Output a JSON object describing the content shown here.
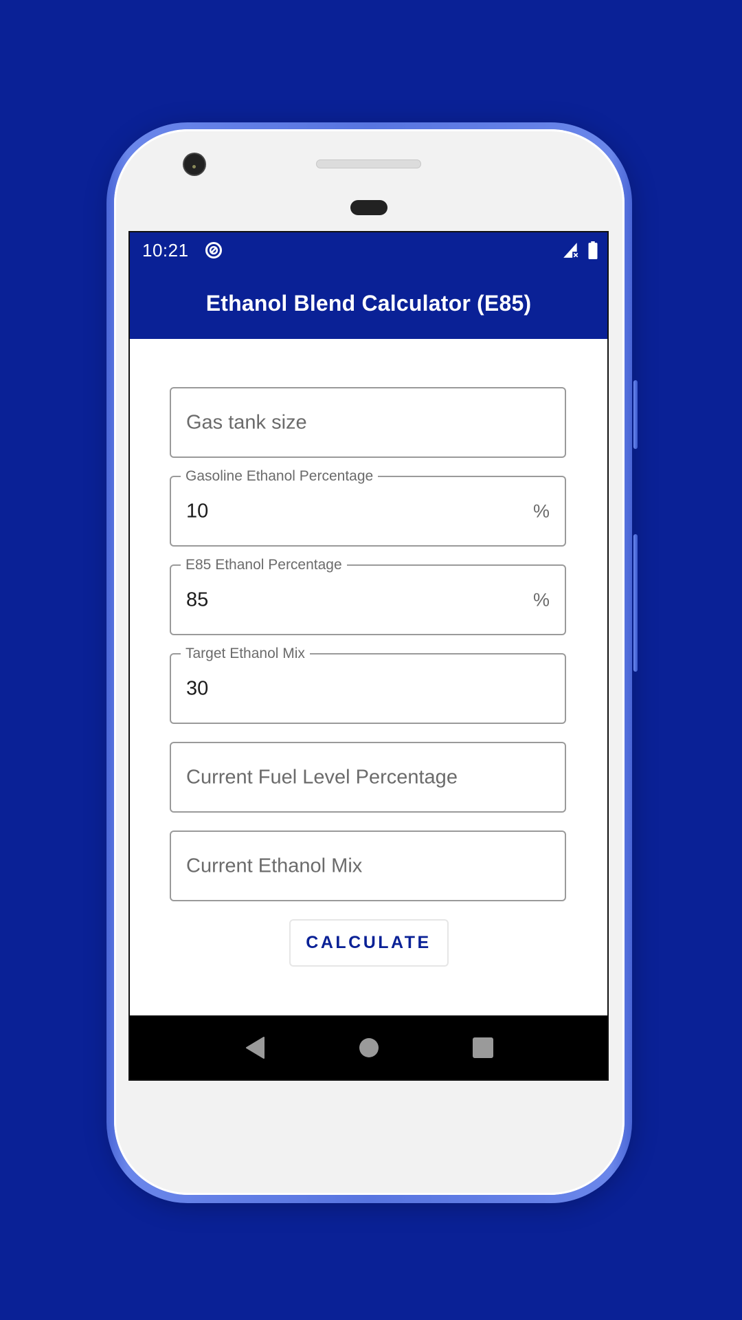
{
  "colors": {
    "background": "#0a2196",
    "app_bar": "#0a2196",
    "accent": "#0a2196",
    "field_border": "#9a9a9a",
    "hint_text": "#6b6b6b",
    "value_text": "#1c1c1c",
    "nav_bar": "#000000"
  },
  "status_bar": {
    "time": "10:21",
    "app_icon": "data-saver-icon",
    "signal_icon": "signal-no-data-icon",
    "battery_icon": "battery-full-icon"
  },
  "app_bar": {
    "title": "Ethanol Blend Calculator (E85)"
  },
  "form": {
    "fields": [
      {
        "name": "gas-tank-size",
        "label": "",
        "placeholder": "Gas tank size",
        "value": "",
        "suffix": ""
      },
      {
        "name": "gasoline-ethanol-percentage",
        "label": "Gasoline Ethanol Percentage",
        "placeholder": "",
        "value": "10",
        "suffix": "%"
      },
      {
        "name": "e85-ethanol-percentage",
        "label": "E85 Ethanol Percentage",
        "placeholder": "",
        "value": "85",
        "suffix": "%"
      },
      {
        "name": "target-ethanol-mix",
        "label": "Target Ethanol Mix",
        "placeholder": "",
        "value": "30",
        "suffix": ""
      },
      {
        "name": "current-fuel-level-percentage",
        "label": "",
        "placeholder": "Current Fuel Level Percentage",
        "value": "",
        "suffix": ""
      },
      {
        "name": "current-ethanol-mix",
        "label": "",
        "placeholder": "Current Ethanol Mix",
        "value": "",
        "suffix": ""
      }
    ],
    "calculate_label": "CALCULATE"
  },
  "nav_bar": {
    "back_icon": "back-triangle-icon",
    "home_icon": "home-circle-icon",
    "recents_icon": "recents-square-icon"
  }
}
